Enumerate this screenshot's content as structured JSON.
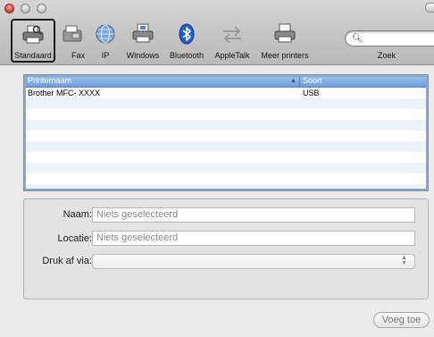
{
  "toolbar": {
    "items": [
      {
        "label": "Standaard",
        "icon": "default-printer-icon"
      },
      {
        "label": "Fax",
        "icon": "fax-icon"
      },
      {
        "label": "IP",
        "icon": "ip-globe-icon"
      },
      {
        "label": "Windows",
        "icon": "windows-printer-icon"
      },
      {
        "label": "Bluetooth",
        "icon": "bluetooth-icon"
      },
      {
        "label": "AppleTalk",
        "icon": "appletalk-arrows-icon"
      },
      {
        "label": "Meer printers",
        "icon": "more-printers-icon"
      }
    ],
    "search_label": "Zoek",
    "search_value": ""
  },
  "printer_list": {
    "columns": [
      "Printernaam",
      "Soort"
    ],
    "rows": [
      {
        "name": "Brother MFC- XXXX",
        "kind": "USB"
      }
    ]
  },
  "details": {
    "name_label": "Naam:",
    "name_value": "Niets geselecteerd",
    "location_label": "Locatie:",
    "location_value": "Niets geselecteerd",
    "print_via_label": "Druk af via:",
    "print_via_value": ""
  },
  "add_button": "Voeg toe",
  "colors": {
    "header_blue": "#7eaee6",
    "accent": "#1c1c1c"
  }
}
